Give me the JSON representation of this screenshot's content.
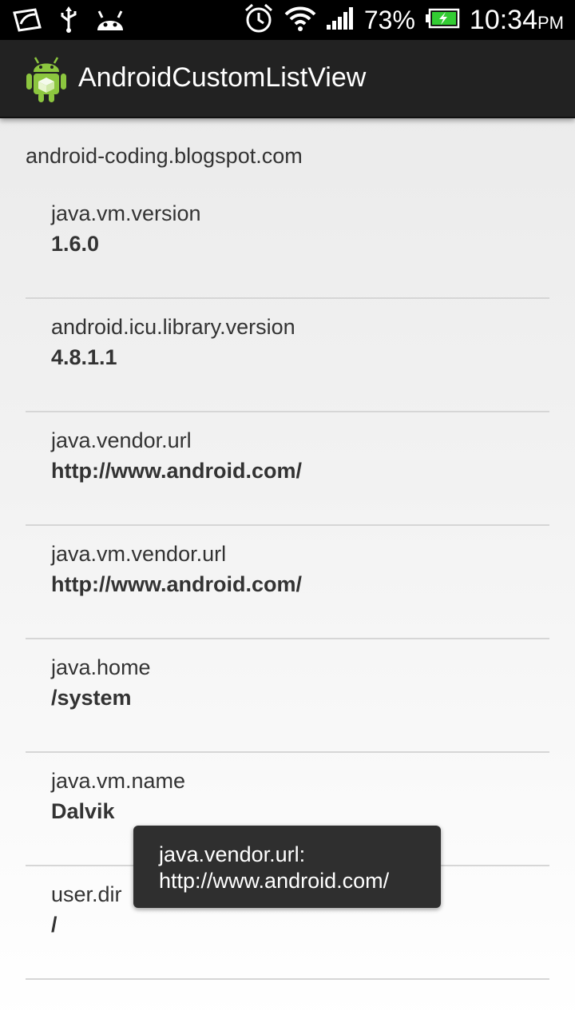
{
  "status_bar": {
    "icons_left": [
      "message-icon",
      "usb-icon",
      "android-debug-icon"
    ],
    "icons_right": [
      "alarm-icon",
      "wifi-icon",
      "signal-icon",
      "battery-charging-icon"
    ],
    "battery_percent": "73%",
    "time": "10:34",
    "ampm": "PM"
  },
  "action_bar": {
    "icon": "android-app-icon",
    "title": "AndroidCustomListView"
  },
  "header": {
    "text": "android-coding.blogspot.com"
  },
  "list": {
    "items": [
      {
        "key": "java.vm.version",
        "value": "1.6.0"
      },
      {
        "key": "android.icu.library.version",
        "value": "4.8.1.1"
      },
      {
        "key": "java.vendor.url",
        "value": "http://www.android.com/"
      },
      {
        "key": "java.vm.vendor.url",
        "value": "http://www.android.com/"
      },
      {
        "key": "java.home",
        "value": "/system"
      },
      {
        "key": "java.vm.name",
        "value": "Dalvik"
      },
      {
        "key": "user.dir",
        "value": "/"
      }
    ]
  },
  "toast": {
    "line1": "java.vendor.url:",
    "line2": "http://www.android.com/"
  },
  "colors": {
    "status_bar_bg": "#000000",
    "action_bar_bg": "#222222",
    "android_green": "#8cc63f",
    "battery_green": "#33cc33",
    "toast_bg": "#2f2f2f"
  }
}
